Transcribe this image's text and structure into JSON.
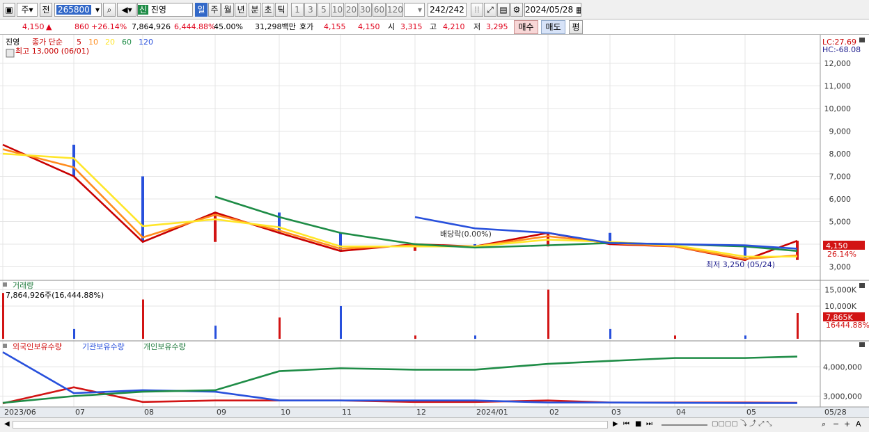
{
  "toolbar": {
    "market_toggle": "주",
    "period_prefix": "전",
    "code": "265800",
    "company_badge": "신",
    "company_name": "진영",
    "periods": [
      "일",
      "주",
      "월",
      "년",
      "분",
      "초",
      "틱"
    ],
    "minute_options": [
      "1",
      "3",
      "5",
      "10",
      "20",
      "30",
      "60",
      "120"
    ],
    "count": "242",
    "count_total": "/242",
    "date": "2024/05/28"
  },
  "price_bar": {
    "price": "4,150",
    "change_arrow": "▲",
    "change": "860",
    "change_pct": "+26.14%",
    "volume": "7,864,926",
    "volume_pct": "6,444.88%",
    "turnover": "45.00%",
    "amount": "31,298백만",
    "ask_label": "호가",
    "ask1": "4,155",
    "ask2": "4,150",
    "open_label": "시",
    "open": "3,315",
    "high_label": "고",
    "high": "4,210",
    "low_label": "저",
    "low": "3,295",
    "buy_label": "매수",
    "sell_label": "매도",
    "avg_label": "평"
  },
  "price_pane": {
    "stock": "진영",
    "legend_title": "종가 단순",
    "ma_labels": [
      "5",
      "10",
      "20",
      "60",
      "120"
    ],
    "ma_colors": [
      "#c80000",
      "#ff8c1e",
      "#ffe628",
      "#1e8c46",
      "#2850dc"
    ],
    "highest": "최고 13,000 (06/01)",
    "lowest": "최저 3,250 (05/24)",
    "dividend": "배당락(0.00%)",
    "lc": "LC:27.69",
    "hc": "HC:-68.08",
    "price_tag": "4,150",
    "pct_tag": "26.14%",
    "y_ticks": [
      "12,000",
      "11,000",
      "10,000",
      "9,000",
      "8,000",
      "7,000",
      "6,000",
      "5,000",
      "4,000",
      "3,000"
    ]
  },
  "volume_pane": {
    "title": "거래량",
    "value": "7,864,926주(16,444.88%)",
    "y_ticks": [
      "15,000K",
      "10,000K"
    ],
    "tag1": "7,865K",
    "tag2": "16444.88%"
  },
  "holdings_pane": {
    "series": [
      "외국인보유수량",
      "기관보유수량",
      "개인보유수량"
    ],
    "colors": [
      "#d21414",
      "#2850dc",
      "#1e8c46"
    ],
    "y_ticks": [
      "4,000,000",
      "3,000,000"
    ]
  },
  "x_axis": {
    "labels": [
      "2023/06",
      "07",
      "08",
      "09",
      "10",
      "11",
      "12",
      "2024/01",
      "02",
      "03",
      "04",
      "05"
    ],
    "right_label": "05/28"
  },
  "chart_data": [
    {
      "type": "line",
      "title": "",
      "ylabel": "",
      "ylim": [
        2800,
        13200
      ],
      "x": [
        "2023/06",
        "07",
        "08",
        "09",
        "10",
        "11",
        "12",
        "2024/01",
        "02",
        "03",
        "04",
        "05",
        "05/28"
      ],
      "series": [
        {
          "name": "5",
          "values": [
            8400,
            7000,
            4100,
            5400,
            4500,
            3700,
            4000,
            3900,
            4500,
            4000,
            3900,
            3300,
            4150
          ]
        },
        {
          "name": "10",
          "values": [
            8200,
            7400,
            4300,
            5300,
            4600,
            3800,
            3950,
            3900,
            4350,
            4050,
            3900,
            3350,
            3500
          ]
        },
        {
          "name": "20",
          "values": [
            8000,
            7800,
            4800,
            5100,
            4750,
            3900,
            3900,
            3900,
            4200,
            4100,
            3950,
            3450,
            3450
          ]
        },
        {
          "name": "60",
          "values": [
            null,
            null,
            null,
            6100,
            5200,
            4500,
            4000,
            3850,
            3950,
            4050,
            4000,
            3900,
            3700
          ]
        },
        {
          "name": "120",
          "values": [
            null,
            null,
            null,
            null,
            null,
            null,
            5200,
            4700,
            4500,
            4050,
            4000,
            3950,
            3800
          ]
        }
      ]
    },
    {
      "type": "bar",
      "title": "거래량",
      "ylim": [
        0,
        17000
      ],
      "x": [
        "2023/06",
        "07",
        "08",
        "09",
        "10",
        "11",
        "12",
        "2024/01",
        "02",
        "03",
        "04",
        "05",
        "05/28"
      ],
      "values": [
        14000,
        3000,
        12000,
        4000,
        6500,
        10000,
        1000,
        1000,
        15000,
        3000,
        1000,
        1000,
        7865
      ]
    },
    {
      "type": "line",
      "title": "",
      "ylim": [
        2700000,
        4600000
      ],
      "x": [
        "2023/06",
        "07",
        "08",
        "09",
        "10",
        "11",
        "12",
        "2024/01",
        "02",
        "03",
        "04",
        "05",
        "05/28"
      ],
      "series": [
        {
          "name": "외국인보유수량",
          "values": [
            2750000,
            3300000,
            2800000,
            2850000,
            2850000,
            2850000,
            2800000,
            2800000,
            2850000,
            2780000,
            2780000,
            2780000,
            2770000
          ]
        },
        {
          "name": "기관보유수량",
          "values": [
            4500000,
            3100000,
            3200000,
            3150000,
            2850000,
            2850000,
            2850000,
            2850000,
            2780000,
            2780000,
            2770000,
            2760000,
            2760000
          ]
        },
        {
          "name": "개인보유수량",
          "values": [
            2770000,
            3000000,
            3150000,
            3200000,
            3850000,
            3950000,
            3900000,
            3900000,
            4100000,
            4200000,
            4300000,
            4300000,
            4350000
          ]
        }
      ]
    }
  ]
}
